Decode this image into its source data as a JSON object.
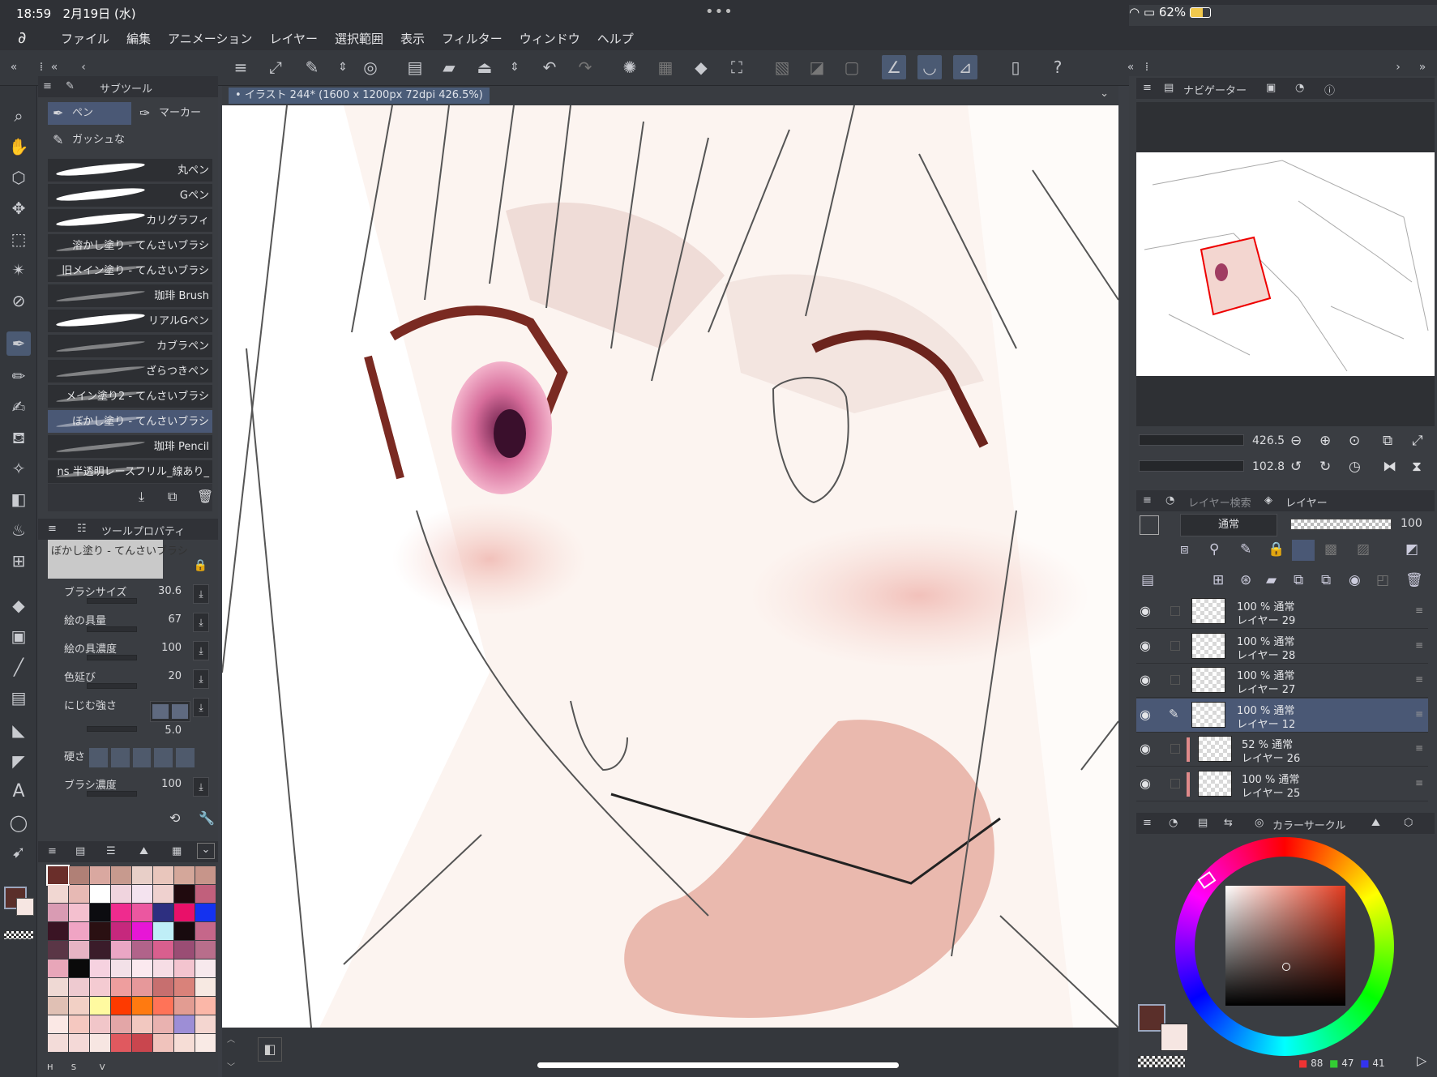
{
  "status": {
    "time": "18:59",
    "date": "2月19日 (水)",
    "dots": "•••",
    "battery": "62%"
  },
  "menu": [
    "ファイル",
    "編集",
    "アニメーション",
    "レイヤー",
    "選択範囲",
    "表示",
    "フィルター",
    "ウィンドウ",
    "ヘルプ"
  ],
  "subtool": {
    "header": "サブツール",
    "tabs": [
      "ペン",
      "マーカー",
      "ガッシュな"
    ],
    "brushes": [
      "丸ペン",
      "Gペン",
      "カリグラフィ",
      "溶かし塗り - てんさいブラシ",
      "旧メイン塗り - てんさいブラシ",
      "珈琲 Brush",
      "リアルGペン",
      "カブラペン",
      "ざらつきペン",
      "メイン塗り2 - てんさいブラシ",
      "ぼかし塗り - てんさいブラシ",
      "珈琲 Pencil",
      "ns 半透明レースフリル_線あり_"
    ]
  },
  "toolprop": {
    "header": "ツールプロパティ",
    "current": "ぼかし塗り - てんさいブラシ",
    "props": [
      {
        "label": "ブラシサイズ",
        "value": "30.6"
      },
      {
        "label": "絵の具量",
        "value": "67"
      },
      {
        "label": "絵の具濃度",
        "value": "100"
      },
      {
        "label": "色延び",
        "value": "20"
      },
      {
        "label": "にじむ強さ",
        "value": "5.0"
      },
      {
        "label": "硬さ",
        "value": ""
      },
      {
        "label": "ブラシ濃度",
        "value": "100"
      }
    ]
  },
  "palette_labels": [
    "H",
    "S",
    "V"
  ],
  "canvas_tab": "イラスト 244* (1600 x 1200px 72dpi 426.5%)",
  "navigator": {
    "header": "ナビゲーター",
    "zoom": "426.5",
    "rotation": "102.8"
  },
  "layers": {
    "tabs": [
      "レイヤー検索",
      "レイヤー"
    ],
    "blend": "通常",
    "opacity": "100",
    "items": [
      {
        "pct": "100 % 通常",
        "name": "レイヤー 29"
      },
      {
        "pct": "100 % 通常",
        "name": "レイヤー 28"
      },
      {
        "pct": "100 % 通常",
        "name": "レイヤー 27"
      },
      {
        "pct": "100 % 通常",
        "name": "レイヤー 12"
      },
      {
        "pct": "52 % 通常",
        "name": "レイヤー 26"
      },
      {
        "pct": "100 % 通常",
        "name": "レイヤー 25"
      }
    ]
  },
  "color": {
    "header": "カラーサークル",
    "r": "88",
    "g": "47",
    "b": "41",
    "main": "#5a2f2a",
    "sub": "#f6e6e2"
  },
  "palette_colors": [
    "#6a2e2a",
    "#b08076",
    "#d9a8a0",
    "#c79a8e",
    "#e8cfc8",
    "#e9c6bc",
    "#d4a79a",
    "#c7958a",
    "#f1d7d2",
    "#e7b9b4",
    "#ffffff",
    "#f0d4de",
    "#f4e3ef",
    "#efd1cf",
    "#200a0e",
    "#c1607c",
    "#d99bb3",
    "#f4c0cf",
    "#0c0c10",
    "#ef2b8e",
    "#eb57a0",
    "#2d2f80",
    "#e91069",
    "#1432f0",
    "#3a1424",
    "#f0a4c4",
    "#2a1012",
    "#c6287d",
    "#e716d6",
    "#bfeef7",
    "#180a0e",
    "#c5678a",
    "#5a3646",
    "#e6b4c4",
    "#3a1c2a",
    "#eaa6c4",
    "#b1638a",
    "#d95f8e",
    "#9a4d74",
    "#b86e8b",
    "#e8a6b9",
    "#0a0a0a",
    "#f6d2e0",
    "#f3e1e8",
    "#fbe9ef",
    "#f6dde5",
    "#f3c4cf",
    "#f7e9ed",
    "#efd9d4",
    "#eecad0",
    "#f4cbd2",
    "#ee9e9e",
    "#e6989a",
    "#c76f6f",
    "#d9827a",
    "#f7e9e2",
    "#e0c0b4",
    "#f2d0c5",
    "#fffaa0",
    "#fe3a00",
    "#ff7a10",
    "#ff7358",
    "#e29c92",
    "#fbb7a8",
    "#fbe8e5",
    "#f5c8c0",
    "#f1c6c9",
    "#e3a6a7",
    "#f2c8c0",
    "#e9b2b0",
    "#9d8ed6",
    "#f4d6d0",
    "#f3dcd9",
    "#f4d9d7",
    "#f7e6e2",
    "#e0595f",
    "#c9464e",
    "#f0c3bc",
    "#f6ddd6",
    "#f9eae5"
  ]
}
